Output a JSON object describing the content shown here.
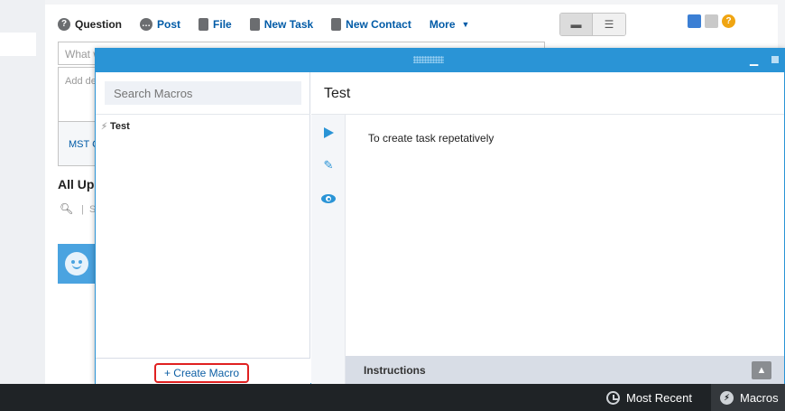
{
  "publisher": {
    "tabs": [
      {
        "label": "Question",
        "icon": "question-icon"
      },
      {
        "label": "Post",
        "icon": "post-icon"
      },
      {
        "label": "File",
        "icon": "file-icon"
      },
      {
        "label": "New Task",
        "icon": "task-icon"
      },
      {
        "label": "New Contact",
        "icon": "contact-icon"
      },
      {
        "label": "More",
        "icon": "chevron-down-icon"
      }
    ],
    "question_placeholder": "What would you like to know?",
    "details_placeholder": "Add de",
    "footer_link": "MST C"
  },
  "feed": {
    "heading": "All Up",
    "separator": "|",
    "extra": "S"
  },
  "macro_panel": {
    "search_placeholder": "Search Macros",
    "items": [
      {
        "label": "Test"
      }
    ],
    "create_label": "+ Create Macro",
    "selected": {
      "title": "Test",
      "description": "To create task repetatively",
      "instructions_label": "Instructions"
    }
  },
  "utility_bar": {
    "most_recent": "Most Recent",
    "macros": "Macros"
  },
  "colors": {
    "panel_header": "#2a94d6",
    "utility_bar": "#1f2326",
    "highlight_border": "#e02020",
    "link": "#015ba7"
  }
}
